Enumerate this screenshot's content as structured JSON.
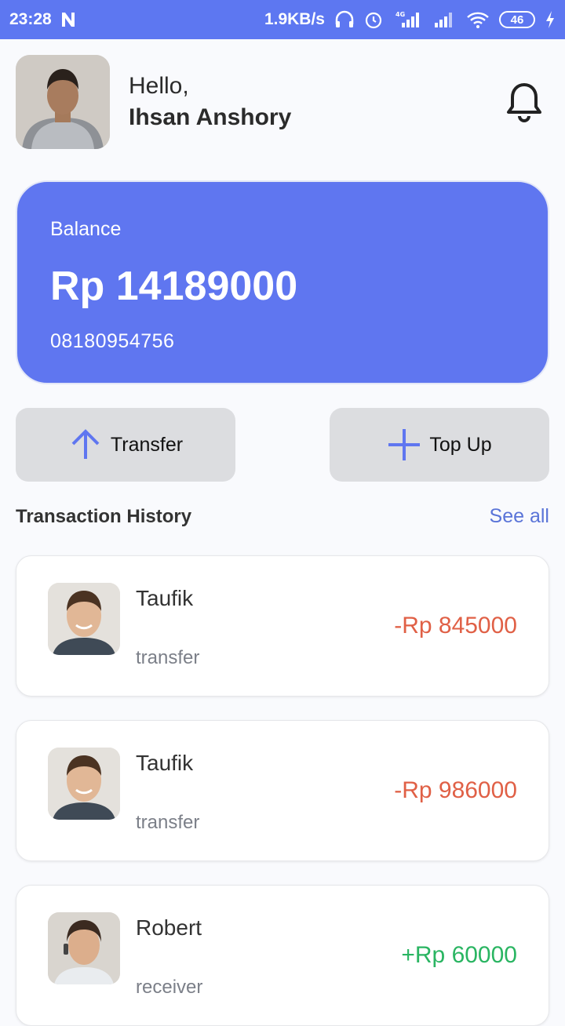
{
  "status_bar": {
    "time": "23:28",
    "network_speed": "1.9KB/s",
    "network_type": "4G",
    "battery": "46"
  },
  "header": {
    "greeting": "Hello,",
    "user_name": "Ihsan Anshory",
    "notification_icon": "bell-icon"
  },
  "balance": {
    "label": "Balance",
    "amount": "Rp 14189000",
    "phone": "08180954756"
  },
  "actions": {
    "transfer_label": "Transfer",
    "topup_label": "Top Up"
  },
  "history": {
    "title": "Transaction History",
    "see_all": "See all",
    "items": [
      {
        "name": "Taufik",
        "type": "transfer",
        "amount": "-Rp 845000"
      },
      {
        "name": "Taufik",
        "type": "transfer",
        "amount": "-Rp 986000"
      },
      {
        "name": "Robert",
        "type": "receiver",
        "amount": "+Rp 60000"
      }
    ]
  },
  "colors": {
    "primary": "#5f76f0",
    "negative": "#e06046",
    "positive": "#2ab562",
    "button_bg": "#dcdde0"
  }
}
